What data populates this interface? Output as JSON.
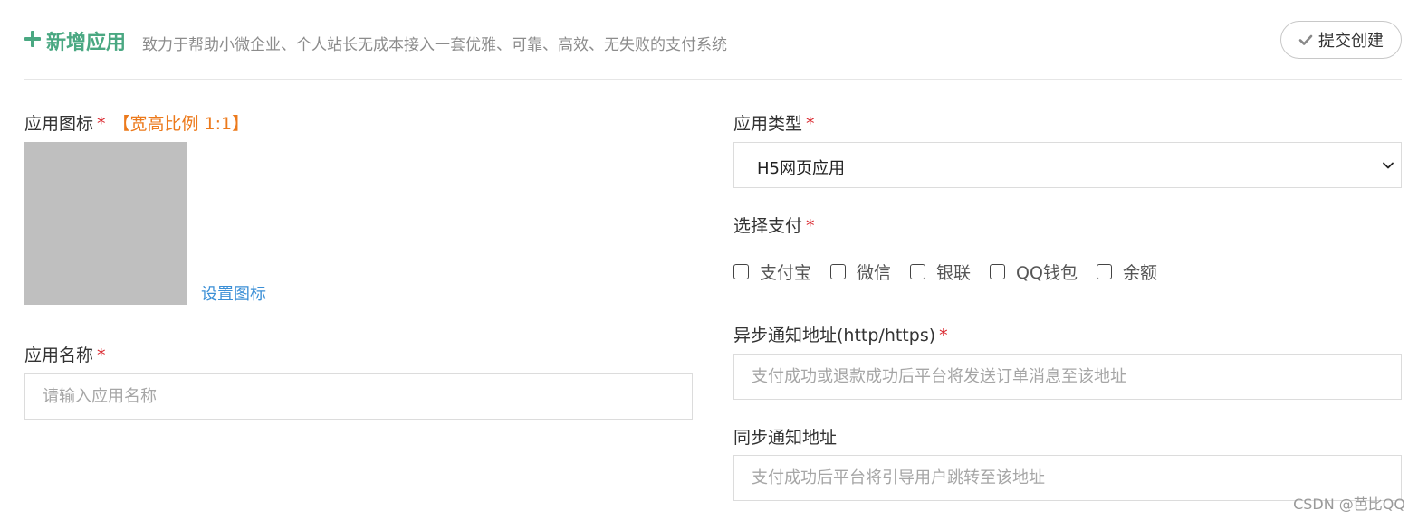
{
  "header": {
    "title": "新增应用",
    "subtitle": "致力于帮助小微企业、个人站长无成本接入一套优雅、可靠、高效、无失败的支付系统",
    "submit_label": "提交创建"
  },
  "form": {
    "app_icon": {
      "label": "应用图标",
      "required_mark": "*",
      "ratio_hint": "【宽高比例 1:1】",
      "set_icon_label": "设置图标"
    },
    "app_name": {
      "label": "应用名称",
      "required_mark": "*",
      "placeholder": "请输入应用名称",
      "value": ""
    },
    "app_type": {
      "label": "应用类型",
      "required_mark": "*",
      "selected": "H5网页应用"
    },
    "payment": {
      "label": "选择支付",
      "required_mark": "*",
      "options": [
        {
          "label": "支付宝",
          "checked": false
        },
        {
          "label": "微信",
          "checked": false
        },
        {
          "label": "银联",
          "checked": false
        },
        {
          "label": "QQ钱包",
          "checked": false
        },
        {
          "label": "余额",
          "checked": false
        }
      ]
    },
    "async_notify": {
      "label": "异步通知地址(http/https)",
      "required_mark": "*",
      "placeholder": "支付成功或退款成功后平台将发送订单消息至该地址",
      "value": ""
    },
    "sync_notify": {
      "label": "同步通知地址",
      "placeholder": "支付成功后平台将引导用户跳转至该地址",
      "value": ""
    }
  },
  "watermark": "CSDN @芭比QQ",
  "colors": {
    "accent": "#4aa882",
    "required": "#d9232a",
    "hint": "#ec7a1c",
    "link": "#3b8fd6",
    "placeholder_box": "#bfbfbf"
  },
  "icons": {
    "header": "plus-icon",
    "submit": "check-icon",
    "select": "chevron-down-icon"
  }
}
